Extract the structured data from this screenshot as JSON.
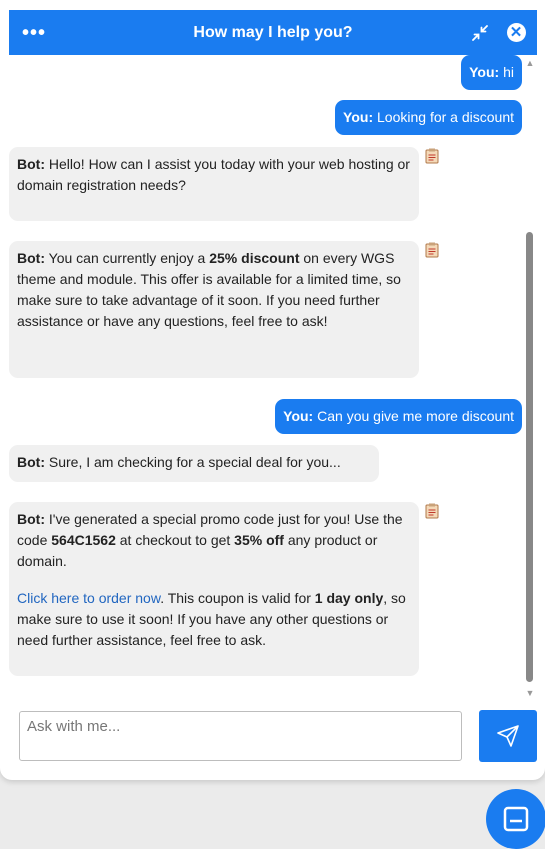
{
  "header": {
    "menu_icon": "more-horizontal-icon",
    "title": "How may I help you?",
    "minimize_icon": "minimize-arrows-icon",
    "close_icon": "close-circle-icon"
  },
  "colors": {
    "accent": "#1a7cf0",
    "bot_bubble": "#f0f0f0",
    "link": "#2166c0"
  },
  "messages": {
    "user_prefix": "You:",
    "bot_prefix": "Bot:",
    "m1": {
      "text": "hi"
    },
    "m2": {
      "text": "Looking for a discount"
    },
    "m3": {
      "text": "Hello! How can I assist you today with your web hosting or domain registration needs?"
    },
    "m4": {
      "t1": "You can currently enjoy a ",
      "b1": "25% discount",
      "t2": " on every WGS theme and module. This offer is available for a limited time, so make sure to take advantage of it soon. If you need further assistance or have any questions, feel free to ask!"
    },
    "m5": {
      "text": "Can you give me more discount"
    },
    "m6": {
      "text": "Sure, I am checking for a special deal for you..."
    },
    "m7": {
      "t1": "I've generated a special promo code just for you! Use the code ",
      "code": "564C1562",
      "t2": " at checkout to get ",
      "b1": "35% off",
      "t3": " any product or domain.",
      "link": "Click here to order now",
      "t4": ". This coupon is valid for ",
      "b2": "1 day only",
      "t5": ", so make sure to use it soon! If you have any other questions or need further assistance, feel free to ask."
    }
  },
  "input": {
    "placeholder": "Ask with me..."
  },
  "send_icon": "send-icon",
  "launcher_icon": "chat-window-icon"
}
